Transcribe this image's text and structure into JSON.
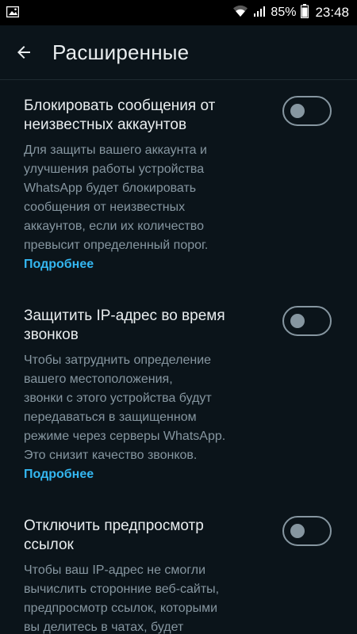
{
  "status_bar": {
    "battery": "85%",
    "time": "23:48",
    "icons": [
      "gallery-icon",
      "wifi-icon",
      "signal-icon",
      "battery-icon"
    ]
  },
  "app_bar": {
    "title": "Расширенные",
    "back_icon": "arrow-left-icon"
  },
  "settings": [
    {
      "title_lines": [
        "Блокировать сообщения от",
        "неизвестных аккаунтов"
      ],
      "desc_lines": [
        "Для защиты вашего аккаунта и",
        "улучшения работы устройства",
        "WhatsApp будет блокировать",
        "сообщения от неизвестных",
        "аккаунтов, если их количество",
        "превысит определенный порог."
      ],
      "learn_more": "Подробнее",
      "enabled": false
    },
    {
      "title_lines": [
        "Защитить IP-адрес во время",
        "звонков"
      ],
      "desc_lines": [
        "Чтобы затруднить определение",
        "вашего местоположения,",
        "звонки с этого устройства будут",
        "передаваться в защищенном",
        "режиме через серверы WhatsApp.",
        "Это снизит качество звонков."
      ],
      "learn_more": "Подробнее",
      "enabled": false
    },
    {
      "title_lines": [
        "Отключить предпросмотр",
        "ссылок"
      ],
      "desc_lines": [
        "Чтобы ваш IP-адрес не смогли",
        "вычислить сторонние веб-сайты,",
        "предпросмотр ссылок, которыми",
        "вы делитесь в чатах, будет"
      ],
      "enabled": false
    }
  ],
  "colors": {
    "background": "#0b141a",
    "title_text": "#e9edef",
    "secondary_text": "#8696a0",
    "link": "#34b7f1"
  }
}
